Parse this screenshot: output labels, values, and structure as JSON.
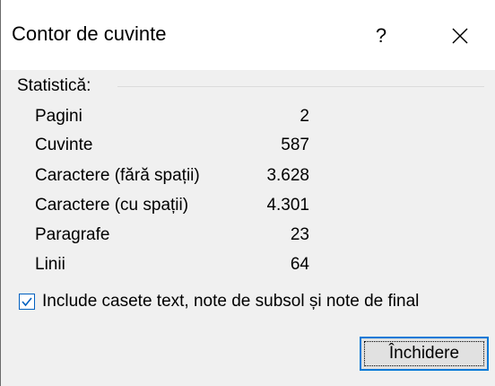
{
  "window": {
    "title": "Contor de cuvinte",
    "help_label": "?",
    "close_icon": "close-icon"
  },
  "statistics": {
    "heading": "Statistică:",
    "rows": [
      {
        "label": "Pagini",
        "value": "2"
      },
      {
        "label": "Cuvinte",
        "value": "587"
      },
      {
        "label": "Caractere (fără spații)",
        "value": "3.628"
      },
      {
        "label": "Caractere (cu spații)",
        "value": "4.301"
      },
      {
        "label": "Paragrafe",
        "value": "23"
      },
      {
        "label": "Linii",
        "value": "64"
      }
    ]
  },
  "options": {
    "include_label": "Include casete text, note de subsol și note de final",
    "include_checked": true
  },
  "actions": {
    "close_label": "Închidere"
  },
  "colors": {
    "accent": "#0078d7",
    "checkbox_border": "#0060c0",
    "dialog_bg": "#f0f0f0",
    "titlebar_bg": "#ffffff",
    "button_bg": "#e1e1e1"
  }
}
